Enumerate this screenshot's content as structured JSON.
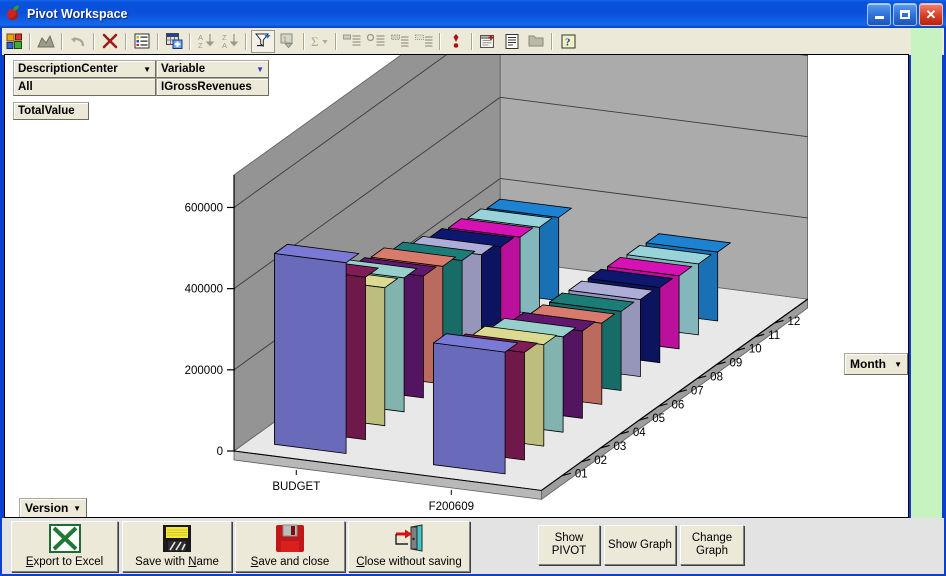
{
  "window": {
    "title": "Pivot Workspace",
    "icon": "apple-icon",
    "buttons": {
      "minimize": "minimize-button",
      "maximize": "maximize-button",
      "close": "close-button"
    }
  },
  "toolbar": {
    "items": [
      {
        "name": "pivot-layout-icon",
        "tip": "Pivot Layout"
      },
      {
        "name": "chart-icon",
        "tip": "Chart"
      },
      {
        "name": "undo-icon",
        "tip": "Undo"
      },
      {
        "name": "delete-icon",
        "tip": "Delete"
      },
      {
        "name": "field-list-icon",
        "tip": "Field List"
      },
      {
        "name": "add-table-icon",
        "tip": "Add Table"
      },
      {
        "name": "sort-ascending-icon",
        "tip": "Sort Ascending"
      },
      {
        "name": "sort-descending-icon",
        "tip": "Sort Descending"
      },
      {
        "name": "autofilter-icon",
        "tip": "AutoFilter"
      },
      {
        "name": "filter-field-icon",
        "tip": "Filter Field"
      },
      {
        "name": "autosum-icon",
        "tip": "AutoSum"
      },
      {
        "name": "expand-item-icon",
        "tip": "Expand Item"
      },
      {
        "name": "collapse-item-icon",
        "tip": "Collapse Item"
      },
      {
        "name": "show-detail-icon",
        "tip": "Show Detail"
      },
      {
        "name": "hide-detail-icon",
        "tip": "Hide Detail"
      },
      {
        "name": "exclamation-icon",
        "tip": "Refresh"
      },
      {
        "name": "new-report-icon",
        "tip": "New Report"
      },
      {
        "name": "properties-icon",
        "tip": "Properties"
      },
      {
        "name": "folder-icon",
        "tip": "Open"
      },
      {
        "name": "help-icon",
        "tip": "Help"
      }
    ]
  },
  "pivot": {
    "fields": [
      {
        "header": "DescriptionCenter",
        "value": "All",
        "caret": "▼"
      },
      {
        "header": "Variable",
        "value": "IGrossRevenues",
        "caret": "▼"
      }
    ],
    "total_label": "TotalValue"
  },
  "month_selector": {
    "label": "Month",
    "caret": "▼"
  },
  "version_selector": {
    "label": "Version",
    "caret": "▼"
  },
  "footer_buttons": [
    {
      "name": "export-to-excel-button",
      "label": "Export to Excel",
      "accel": "E",
      "icon": "excel-icon"
    },
    {
      "name": "save-with-name-button",
      "label": "Save with Name",
      "accel": "N",
      "icon": "floppy-yellow-icon"
    },
    {
      "name": "save-and-close-button",
      "label": "Save and close",
      "accel": "S",
      "icon": "floppy-red-icon"
    },
    {
      "name": "close-without-saving-button",
      "label": "Close without saving",
      "accel": "C",
      "icon": "exit-door-icon"
    }
  ],
  "action_buttons": [
    {
      "name": "show-pivot-button",
      "line1": "Show",
      "line2": "PIVOT"
    },
    {
      "name": "show-graph-button",
      "line1": "Show Graph",
      "line2": ""
    },
    {
      "name": "change-graph-button",
      "line1": "Change",
      "line2": "Graph"
    }
  ],
  "colors": {
    "titlebar": "#0a4fd8",
    "toolbar": "#ece9d8",
    "client": "#ffffff",
    "side_panel": "#c6f3c0",
    "bottom_bar": "#e3e3e3",
    "wall_back": "#8f8f8f",
    "wall_side": "#a6a6a6",
    "floor": "#e8e8e8"
  },
  "chart_data": {
    "type": "bar",
    "title": "",
    "subtitle": "",
    "xlabel": "",
    "ylabel": "TotalValue",
    "zlabel": "Month",
    "grid": true,
    "legend_position": "none",
    "is_3d": true,
    "yticks": [
      "0",
      "200000",
      "400000",
      "600000"
    ],
    "ylim": [
      0,
      680000
    ],
    "categories": [
      "BUDGET",
      "F200609"
    ],
    "months": [
      "01",
      "02",
      "03",
      "04",
      "05",
      "06",
      "07",
      "08",
      "09",
      "10",
      "11",
      "12"
    ],
    "month_colors": [
      "#8888ee",
      "#8e2060",
      "#f2f2a0",
      "#a8e6e0",
      "#6a1b7a",
      "#f08878",
      "#1f8a84",
      "#c0c0f0",
      "#101a7a",
      "#ee14c8",
      "#a8eaf0",
      "#2090e8"
    ],
    "series": [
      {
        "name": "BUDGET",
        "values": [
          470000,
          400000,
          340000,
          330000,
          300000,
          290000,
          270000,
          250000,
          235000,
          225000,
          215000,
          205000
        ]
      },
      {
        "name": "F200609",
        "values": [
          300000,
          265000,
          250000,
          235000,
          215000,
          200000,
          195000,
          190000,
          185000,
          180000,
          175000,
          170000
        ]
      }
    ],
    "axis_labels": {
      "x_series": [
        "BUDGET",
        "F200609"
      ],
      "z_months": [
        "01",
        "02",
        "03",
        "04",
        "05",
        "06",
        "07",
        "08",
        "09",
        "10",
        "11",
        "12"
      ]
    }
  }
}
